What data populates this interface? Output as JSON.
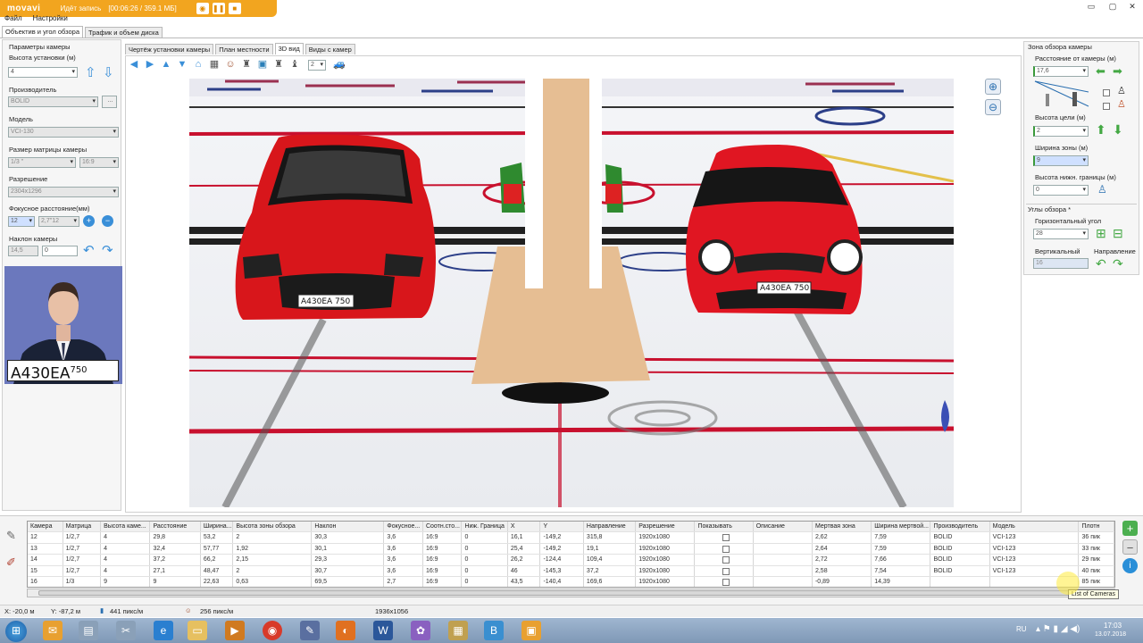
{
  "recorder": {
    "logo": "movavi",
    "status": "Идёт запись",
    "timer": "[00:06:26 / 359.1 МБ]"
  },
  "menu": {
    "file": "Файл",
    "settings": "Настройки"
  },
  "main_tabs": [
    "Объектив и угол обзора",
    "Трафик и объем диска"
  ],
  "left_panel": {
    "title": "Параметры камеры",
    "height_label": "Высота установки (м)",
    "height_value": "4",
    "manufacturer_label": "Производитель",
    "manufacturer_value": "BOLID",
    "model_label": "Модель",
    "model_value": "VCI-130",
    "matrix_label": "Размер матрицы камеры",
    "matrix_value": "1/3 \"",
    "aspect_value": "16:9",
    "resolution_label": "Разрешение",
    "resolution_value": "2304x1296",
    "focal_label": "Фокусное расстояние(мм)",
    "focal_value": "12",
    "focal_range": "2,7\"12",
    "tilt_label": "Наклон камеры",
    "tilt_value1": "14,5",
    "tilt_value2": "0",
    "preview_plate": "А430ЕА",
    "preview_region": "750"
  },
  "view_tabs": [
    "Чертёж установки камеры",
    "План местности",
    "3D вид",
    "Виды с камер"
  ],
  "toolbar": {
    "count_value": "2"
  },
  "scene": {
    "plate_left": "А430ЕА 750",
    "plate_right": "А430ЕА 750"
  },
  "right_panel": {
    "title": "Зона обзора камеры",
    "distance_label": "Расстояние от камеры (м)",
    "distance_value": "17,6",
    "target_height_label": "Высота цели (м)",
    "target_height_value": "2",
    "zone_width_label": "Ширина зоны (м)",
    "zone_width_value": "9",
    "lower_bound_label": "Высота нижн. границы (м)",
    "lower_bound_value": "0",
    "angles_title": "Углы обзора *",
    "hangle_label": "Горизонтальный угол",
    "hangle_value": "28",
    "vangle_label": "Вертикальный",
    "vangle_value": "16",
    "direction_label": "Направление"
  },
  "table": {
    "headers": [
      "Камера",
      "Матрица",
      "Высота каме...",
      "Расстояние",
      "Ширина...",
      "Высота зоны обзора",
      "Наклон",
      "Фокусное...",
      "Соотн.сто...",
      "Ниж. Граница",
      "X",
      "Y",
      "Направление",
      "Разрешение",
      "Показывать",
      "Описание",
      "Мертвая зона",
      "Ширина мертвой...",
      "Производитель",
      "Модель",
      "Плотн"
    ],
    "rows": [
      [
        "12",
        "1/2,7",
        "4",
        "29,8",
        "53,2",
        "2",
        "30,3",
        "3,6",
        "16:9",
        "0",
        "16,1",
        "-149,2",
        "315,8",
        "1920x1080",
        "",
        "",
        "2,62",
        "7,59",
        "BOLID",
        "VCI-123",
        "36 пик"
      ],
      [
        "13",
        "1/2,7",
        "4",
        "32,4",
        "57,77",
        "1,92",
        "30,1",
        "3,6",
        "16:9",
        "0",
        "25,4",
        "-149,2",
        "19,1",
        "1920x1080",
        "",
        "",
        "2,64",
        "7,59",
        "BOLID",
        "VCI-123",
        "33 пик"
      ],
      [
        "14",
        "1/2,7",
        "4",
        "37,2",
        "66,2",
        "2,15",
        "29,3",
        "3,6",
        "16:9",
        "0",
        "26,2",
        "-124,4",
        "109,4",
        "1920x1080",
        "",
        "",
        "2,72",
        "7,66",
        "BOLID",
        "VCI-123",
        "29 пик"
      ],
      [
        "15",
        "1/2,7",
        "4",
        "27,1",
        "48,47",
        "2",
        "30,7",
        "3,6",
        "16:9",
        "0",
        "46",
        "-145,3",
        "37,2",
        "1920x1080",
        "",
        "",
        "2,58",
        "7,54",
        "BOLID",
        "VCI-123",
        "40 пик"
      ],
      [
        "16",
        "1/3",
        "9",
        "9",
        "22,63",
        "0,63",
        "69,5",
        "2,7",
        "16:9",
        "0",
        "43,5",
        "-140,4",
        "169,6",
        "1920x1080",
        "",
        "",
        "-0,89",
        "14,39",
        "",
        "",
        "85 пик"
      ]
    ],
    "tooltip": "List of Cameras"
  },
  "status": {
    "x": "X: -20,0 м",
    "y": "Y: -87,2 м",
    "density1": "441 пикс/м",
    "density2": "256 пикс/м",
    "resolution": "1936x1056"
  },
  "taskbar": {
    "lang": "RU",
    "time": "17:03",
    "date": "13.07.2018"
  }
}
